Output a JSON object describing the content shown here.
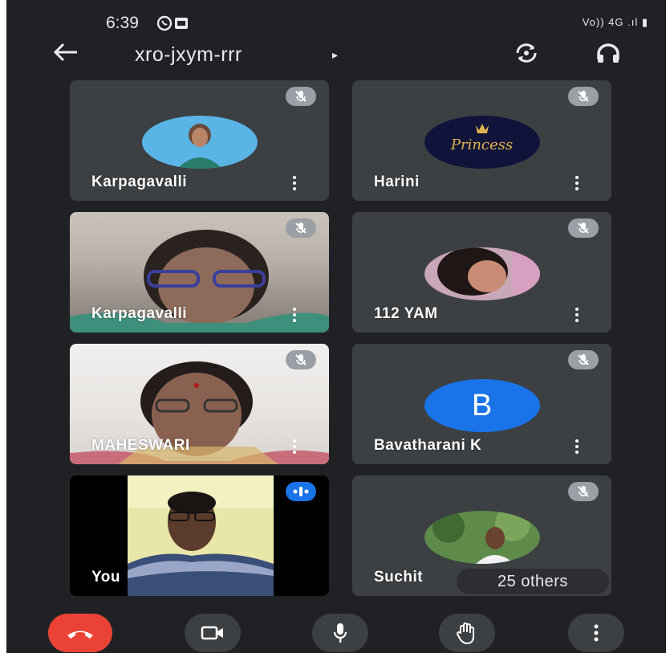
{
  "status_bar": {
    "time": "6:39",
    "right_icons": "Vo)) 4G .ıl ▮"
  },
  "header": {
    "meeting_code": "xro-jxym-rrr",
    "caret": "▸"
  },
  "participants": [
    {
      "name": "Karpagavalli",
      "type": "avatar-photo",
      "muted": true
    },
    {
      "name": "Harini",
      "type": "avatar-logo",
      "logo_text": "Princess",
      "muted": true
    },
    {
      "name": "Karpagavalli",
      "type": "video",
      "muted": true
    },
    {
      "name": "112 YAM",
      "type": "avatar-photo",
      "muted": true
    },
    {
      "name": "MAHESWARI",
      "type": "video",
      "muted": true
    },
    {
      "name": "Bavatharani K",
      "type": "avatar-letter",
      "letter": "B",
      "avatar_color": "#1a73e8",
      "muted": true
    },
    {
      "name": "You",
      "type": "video",
      "muted": false,
      "speaking": true
    },
    {
      "name": "Suchit",
      "type": "avatar-photo",
      "muted": true
    }
  ],
  "others_badge": "25 others",
  "controls": [
    "end-call",
    "camera",
    "microphone",
    "raise-hand",
    "more-options"
  ],
  "colors": {
    "background": "#202124",
    "tile": "#3c4043",
    "end_call": "#ea4335",
    "accent": "#1a73e8"
  }
}
